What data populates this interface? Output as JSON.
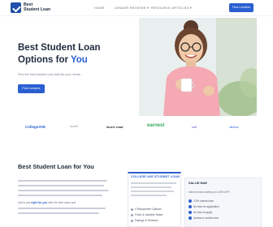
{
  "header": {
    "logo_line1": "Best",
    "logo_line2": "Student Loan",
    "nav_home": "HOME",
    "nav_reviews": "LENDER REVIEWS ▾",
    "nav_articles": "RESOURCE ARTICLES ▾",
    "find_button": "Find Lenders"
  },
  "hero": {
    "title_line1": "Best Student Loan",
    "title_line2_prefix": "Options for ",
    "title_accent": "You",
    "subtitle": "Find the best student loan that fits your needs.",
    "find_button": "Find Lenders"
  },
  "partners": [
    "CollegeAVE",
    "ascent",
    "laurel road",
    "earnest",
    "sofi",
    "citizens"
  ],
  "article": {
    "title": "Best Student Loan for You",
    "highlight_prefix": "that is just ",
    "highlight": "right for you",
    "highlight_suffix": " with the best rates and"
  },
  "mid_card": {
    "heading": "COLLEGE AVE STUDENT LOAN",
    "items": [
      "4 Repayment Options",
      "Fixed & Variable Rates",
      "Ratings & Reviews"
    ]
  },
  "right_card": {
    "title": "SALLIE MAE",
    "subtitle": "Interest rates starting at 4.35% APR",
    "items": [
      "4.5% interest rate",
      "No fees for application",
      "No fees to apply",
      "Access to credit union"
    ]
  },
  "colors": {
    "primary": "#2a5fd1",
    "heading": "#1f2a3d",
    "earnest_green": "#35a85c"
  }
}
